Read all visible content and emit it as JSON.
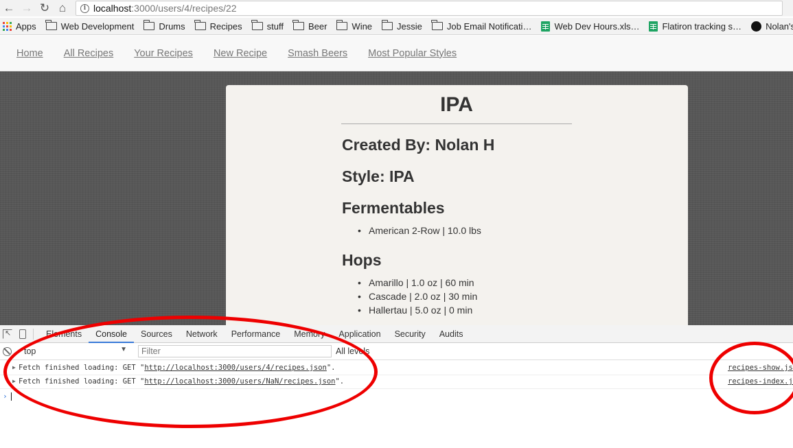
{
  "browser": {
    "url_host": "localhost",
    "url_path": ":3000/users/4/recipes/22",
    "bookmarks": [
      {
        "label": "Apps",
        "icon": "apps-grid-icon"
      },
      {
        "label": "Web Development",
        "icon": "folder-icon"
      },
      {
        "label": "Drums",
        "icon": "folder-icon"
      },
      {
        "label": "Recipes",
        "icon": "folder-icon"
      },
      {
        "label": "stuff",
        "icon": "folder-icon"
      },
      {
        "label": "Beer",
        "icon": "folder-icon"
      },
      {
        "label": "Wine",
        "icon": "folder-icon"
      },
      {
        "label": "Jessie",
        "icon": "folder-icon"
      },
      {
        "label": "Job Email Notificati…",
        "icon": "folder-icon"
      },
      {
        "label": "Web Dev Hours.xls…",
        "icon": "sheets-icon"
      },
      {
        "label": "Flatiron tracking s…",
        "icon": "sheets-icon"
      },
      {
        "label": "Nolan's Repo",
        "icon": "github-icon"
      }
    ]
  },
  "nav": {
    "links": [
      "Home",
      "All Recipes",
      "Your Recipes",
      "New Recipe",
      "Smash Beers",
      "Most Popular Styles"
    ]
  },
  "recipe": {
    "title": "IPA",
    "created_by": "Created By: Nolan H",
    "style": "Style: IPA",
    "fermentables_heading": "Fermentables",
    "fermentables": [
      "American 2-Row | 10.0 lbs"
    ],
    "hops_heading": "Hops",
    "hops": [
      "Amarillo | 1.0 oz | 60 min",
      "Cascade | 2.0 oz | 30 min",
      "Hallertau | 5.0 oz | 0 min"
    ]
  },
  "devtools": {
    "tabs": [
      "Elements",
      "Console",
      "Sources",
      "Network",
      "Performance",
      "Memory",
      "Application",
      "Security",
      "Audits"
    ],
    "active_tab": "Console",
    "context": "top",
    "filter_placeholder": "Filter",
    "levels": "All levels",
    "logs": [
      {
        "prefix": "Fetch finished loading: GET \"",
        "url": "http://localhost:3000/users/4/recipes.json",
        "suffix": "\".",
        "source": "recipes-show.js"
      },
      {
        "prefix": "Fetch finished loading: GET \"",
        "url": "http://localhost:3000/users/NaN/recipes.json",
        "suffix": "\".",
        "source": "recipes-index.js"
      }
    ]
  },
  "colors": {
    "annotation": "#ee0000",
    "devtools_active_tab": "#3879d9",
    "page_background": "#575757",
    "card_background": "#f4f2ee"
  }
}
